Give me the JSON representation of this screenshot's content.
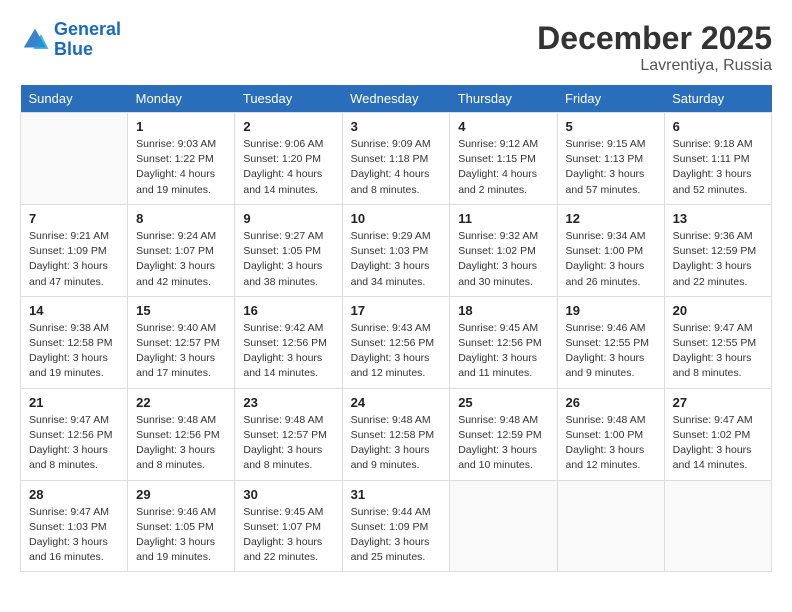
{
  "logo": {
    "line1": "General",
    "line2": "Blue"
  },
  "title": "December 2025",
  "location": "Lavrentiya, Russia",
  "days_header": [
    "Sunday",
    "Monday",
    "Tuesday",
    "Wednesday",
    "Thursday",
    "Friday",
    "Saturday"
  ],
  "weeks": [
    [
      {
        "day": "",
        "sunrise": "",
        "sunset": "",
        "daylight": ""
      },
      {
        "day": "1",
        "sunrise": "Sunrise: 9:03 AM",
        "sunset": "Sunset: 1:22 PM",
        "daylight": "Daylight: 4 hours and 19 minutes."
      },
      {
        "day": "2",
        "sunrise": "Sunrise: 9:06 AM",
        "sunset": "Sunset: 1:20 PM",
        "daylight": "Daylight: 4 hours and 14 minutes."
      },
      {
        "day": "3",
        "sunrise": "Sunrise: 9:09 AM",
        "sunset": "Sunset: 1:18 PM",
        "daylight": "Daylight: 4 hours and 8 minutes."
      },
      {
        "day": "4",
        "sunrise": "Sunrise: 9:12 AM",
        "sunset": "Sunset: 1:15 PM",
        "daylight": "Daylight: 4 hours and 2 minutes."
      },
      {
        "day": "5",
        "sunrise": "Sunrise: 9:15 AM",
        "sunset": "Sunset: 1:13 PM",
        "daylight": "Daylight: 3 hours and 57 minutes."
      },
      {
        "day": "6",
        "sunrise": "Sunrise: 9:18 AM",
        "sunset": "Sunset: 1:11 PM",
        "daylight": "Daylight: 3 hours and 52 minutes."
      }
    ],
    [
      {
        "day": "7",
        "sunrise": "Sunrise: 9:21 AM",
        "sunset": "Sunset: 1:09 PM",
        "daylight": "Daylight: 3 hours and 47 minutes."
      },
      {
        "day": "8",
        "sunrise": "Sunrise: 9:24 AM",
        "sunset": "Sunset: 1:07 PM",
        "daylight": "Daylight: 3 hours and 42 minutes."
      },
      {
        "day": "9",
        "sunrise": "Sunrise: 9:27 AM",
        "sunset": "Sunset: 1:05 PM",
        "daylight": "Daylight: 3 hours and 38 minutes."
      },
      {
        "day": "10",
        "sunrise": "Sunrise: 9:29 AM",
        "sunset": "Sunset: 1:03 PM",
        "daylight": "Daylight: 3 hours and 34 minutes."
      },
      {
        "day": "11",
        "sunrise": "Sunrise: 9:32 AM",
        "sunset": "Sunset: 1:02 PM",
        "daylight": "Daylight: 3 hours and 30 minutes."
      },
      {
        "day": "12",
        "sunrise": "Sunrise: 9:34 AM",
        "sunset": "Sunset: 1:00 PM",
        "daylight": "Daylight: 3 hours and 26 minutes."
      },
      {
        "day": "13",
        "sunrise": "Sunrise: 9:36 AM",
        "sunset": "Sunset: 12:59 PM",
        "daylight": "Daylight: 3 hours and 22 minutes."
      }
    ],
    [
      {
        "day": "14",
        "sunrise": "Sunrise: 9:38 AM",
        "sunset": "Sunset: 12:58 PM",
        "daylight": "Daylight: 3 hours and 19 minutes."
      },
      {
        "day": "15",
        "sunrise": "Sunrise: 9:40 AM",
        "sunset": "Sunset: 12:57 PM",
        "daylight": "Daylight: 3 hours and 17 minutes."
      },
      {
        "day": "16",
        "sunrise": "Sunrise: 9:42 AM",
        "sunset": "Sunset: 12:56 PM",
        "daylight": "Daylight: 3 hours and 14 minutes."
      },
      {
        "day": "17",
        "sunrise": "Sunrise: 9:43 AM",
        "sunset": "Sunset: 12:56 PM",
        "daylight": "Daylight: 3 hours and 12 minutes."
      },
      {
        "day": "18",
        "sunrise": "Sunrise: 9:45 AM",
        "sunset": "Sunset: 12:56 PM",
        "daylight": "Daylight: 3 hours and 11 minutes."
      },
      {
        "day": "19",
        "sunrise": "Sunrise: 9:46 AM",
        "sunset": "Sunset: 12:55 PM",
        "daylight": "Daylight: 3 hours and 9 minutes."
      },
      {
        "day": "20",
        "sunrise": "Sunrise: 9:47 AM",
        "sunset": "Sunset: 12:55 PM",
        "daylight": "Daylight: 3 hours and 8 minutes."
      }
    ],
    [
      {
        "day": "21",
        "sunrise": "Sunrise: 9:47 AM",
        "sunset": "Sunset: 12:56 PM",
        "daylight": "Daylight: 3 hours and 8 minutes."
      },
      {
        "day": "22",
        "sunrise": "Sunrise: 9:48 AM",
        "sunset": "Sunset: 12:56 PM",
        "daylight": "Daylight: 3 hours and 8 minutes."
      },
      {
        "day": "23",
        "sunrise": "Sunrise: 9:48 AM",
        "sunset": "Sunset: 12:57 PM",
        "daylight": "Daylight: 3 hours and 8 minutes."
      },
      {
        "day": "24",
        "sunrise": "Sunrise: 9:48 AM",
        "sunset": "Sunset: 12:58 PM",
        "daylight": "Daylight: 3 hours and 9 minutes."
      },
      {
        "day": "25",
        "sunrise": "Sunrise: 9:48 AM",
        "sunset": "Sunset: 12:59 PM",
        "daylight": "Daylight: 3 hours and 10 minutes."
      },
      {
        "day": "26",
        "sunrise": "Sunrise: 9:48 AM",
        "sunset": "Sunset: 1:00 PM",
        "daylight": "Daylight: 3 hours and 12 minutes."
      },
      {
        "day": "27",
        "sunrise": "Sunrise: 9:47 AM",
        "sunset": "Sunset: 1:02 PM",
        "daylight": "Daylight: 3 hours and 14 minutes."
      }
    ],
    [
      {
        "day": "28",
        "sunrise": "Sunrise: 9:47 AM",
        "sunset": "Sunset: 1:03 PM",
        "daylight": "Daylight: 3 hours and 16 minutes."
      },
      {
        "day": "29",
        "sunrise": "Sunrise: 9:46 AM",
        "sunset": "Sunset: 1:05 PM",
        "daylight": "Daylight: 3 hours and 19 minutes."
      },
      {
        "day": "30",
        "sunrise": "Sunrise: 9:45 AM",
        "sunset": "Sunset: 1:07 PM",
        "daylight": "Daylight: 3 hours and 22 minutes."
      },
      {
        "day": "31",
        "sunrise": "Sunrise: 9:44 AM",
        "sunset": "Sunset: 1:09 PM",
        "daylight": "Daylight: 3 hours and 25 minutes."
      },
      {
        "day": "",
        "sunrise": "",
        "sunset": "",
        "daylight": ""
      },
      {
        "day": "",
        "sunrise": "",
        "sunset": "",
        "daylight": ""
      },
      {
        "day": "",
        "sunrise": "",
        "sunset": "",
        "daylight": ""
      }
    ]
  ]
}
